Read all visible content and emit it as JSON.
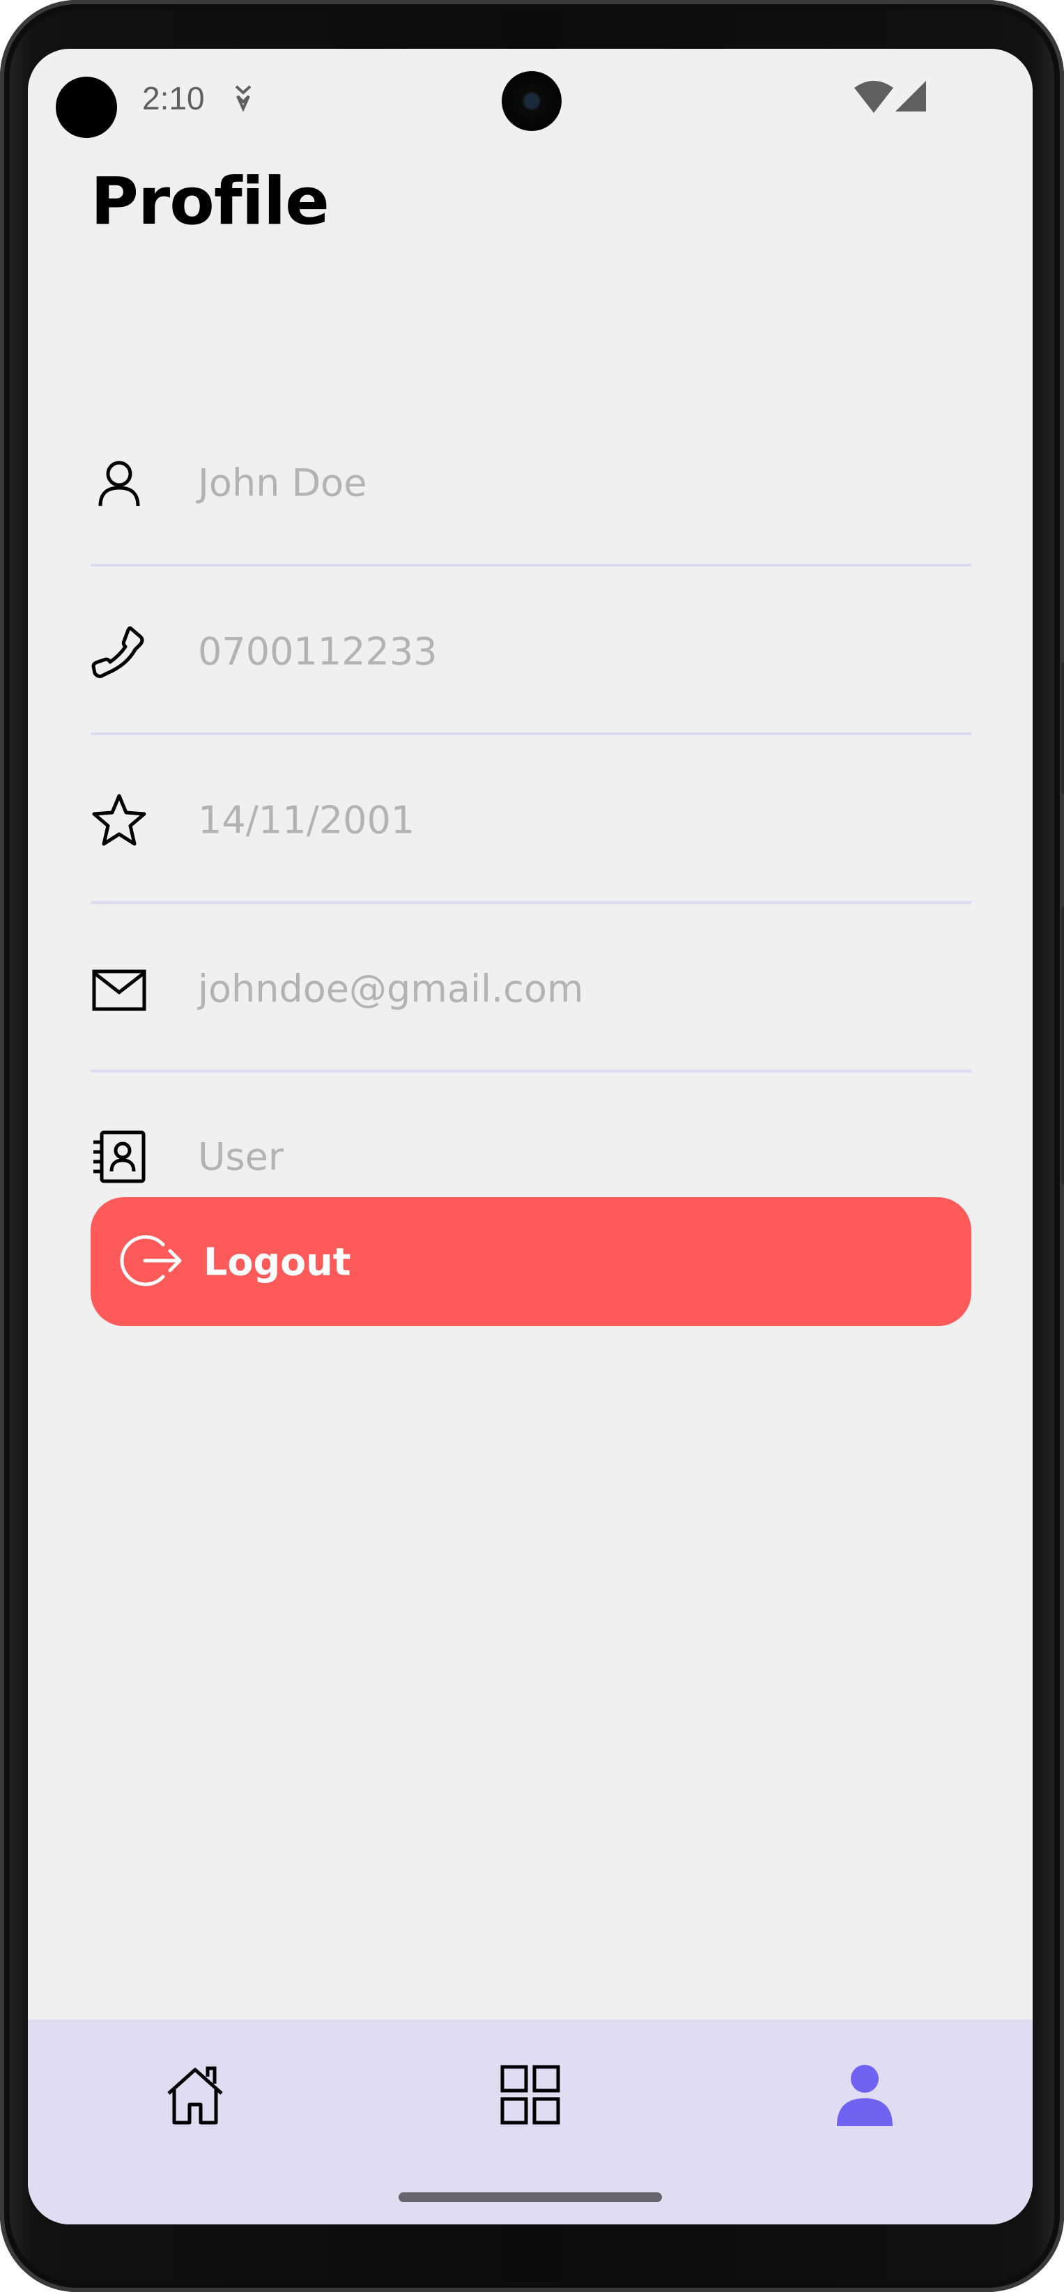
{
  "status_bar": {
    "time": "2:10",
    "icons": [
      "notification-icon",
      "wifi-icon",
      "cellular-signal-icon"
    ]
  },
  "page": {
    "title": "Profile"
  },
  "profile_fields": [
    {
      "icon": "person-icon",
      "value": "John Doe"
    },
    {
      "icon": "phone-icon",
      "value": "0700112233"
    },
    {
      "icon": "star-icon",
      "value": "14/11/2001"
    },
    {
      "icon": "mail-icon",
      "value": "johndoe@gmail.com"
    },
    {
      "icon": "contact-book-icon",
      "value": "User"
    }
  ],
  "logout_button": {
    "label": "Logout",
    "icon": "logout-icon"
  },
  "bottom_nav": {
    "items": [
      {
        "icon": "home-icon",
        "active": false
      },
      {
        "icon": "grid-icon",
        "active": false
      },
      {
        "icon": "profile-icon",
        "active": true
      }
    ]
  },
  "colors": {
    "background": "#f0f0f0",
    "placeholder_text": "#b3b3b3",
    "divider": "#dcdaf0",
    "logout_button": "#fe5a5a",
    "bottom_nav_bg": "#e0dcf1",
    "accent": "#7163f2"
  }
}
